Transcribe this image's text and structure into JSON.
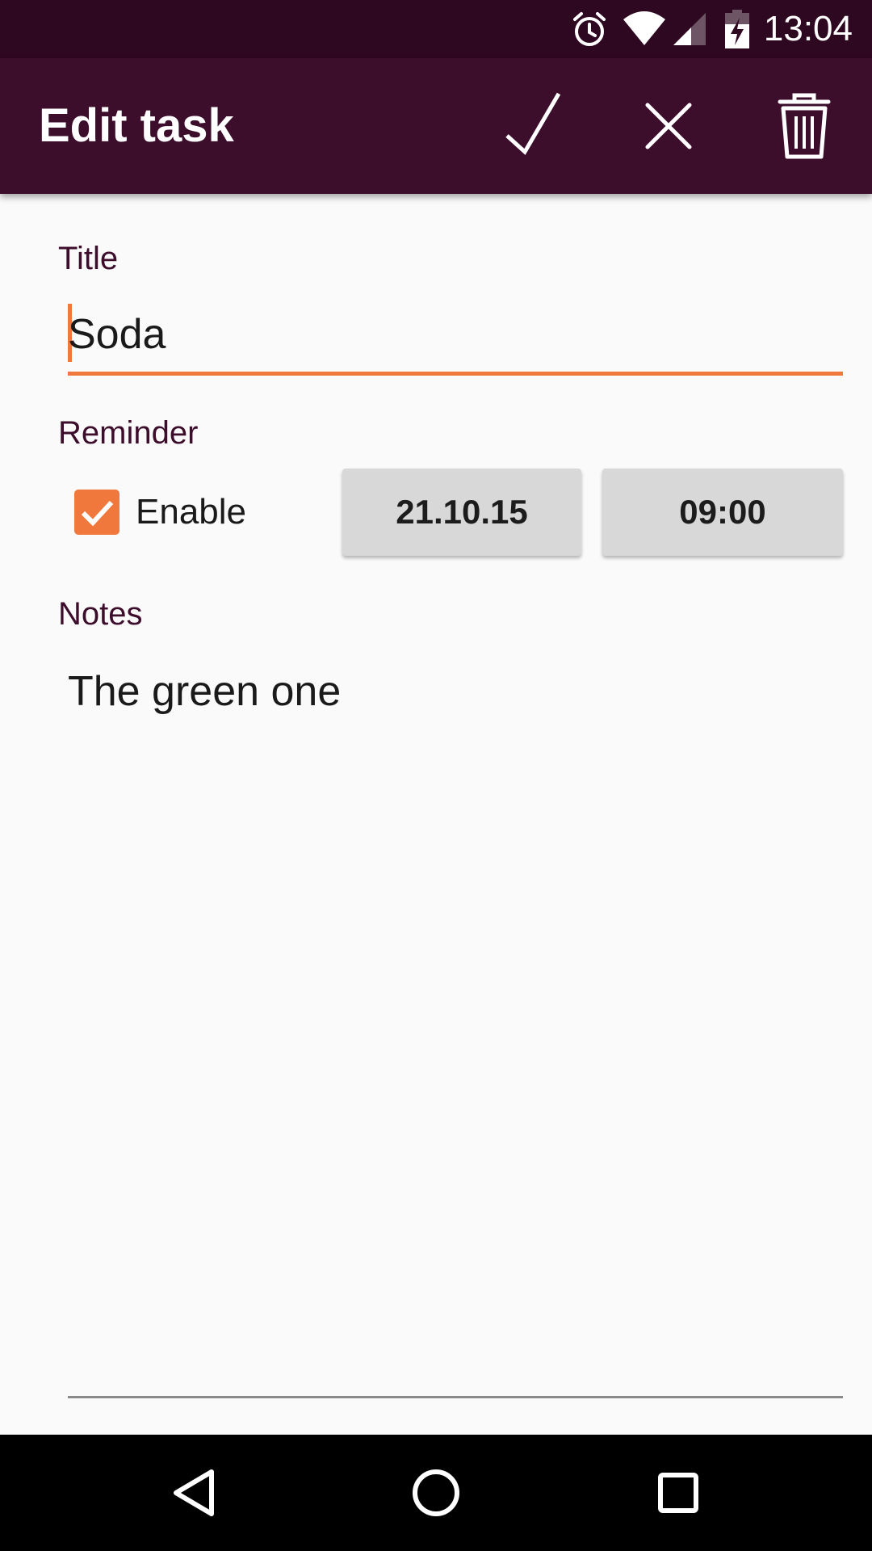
{
  "status_bar": {
    "time": "13:04",
    "icons": [
      "alarm-icon",
      "wifi-icon",
      "signal-icon",
      "battery-charging-icon"
    ]
  },
  "app_bar": {
    "title": "Edit task",
    "actions": [
      "check-icon",
      "close-icon",
      "delete-icon"
    ]
  },
  "form": {
    "title_label": "Title",
    "title_value": "Soda",
    "reminder_label": "Reminder",
    "enable_label": "Enable",
    "enable_checked": true,
    "date_value": "21.10.15",
    "time_value": "09:00",
    "notes_label": "Notes",
    "notes_value": "The green one"
  },
  "nav_bar": {
    "buttons": [
      "back-icon",
      "home-icon",
      "recents-icon"
    ]
  },
  "colors": {
    "status_bar": "#2e0720",
    "app_bar": "#3d0e2c",
    "accent": "#f0783c",
    "label": "#3d0e2c",
    "button_bg": "#d7d8d7"
  }
}
